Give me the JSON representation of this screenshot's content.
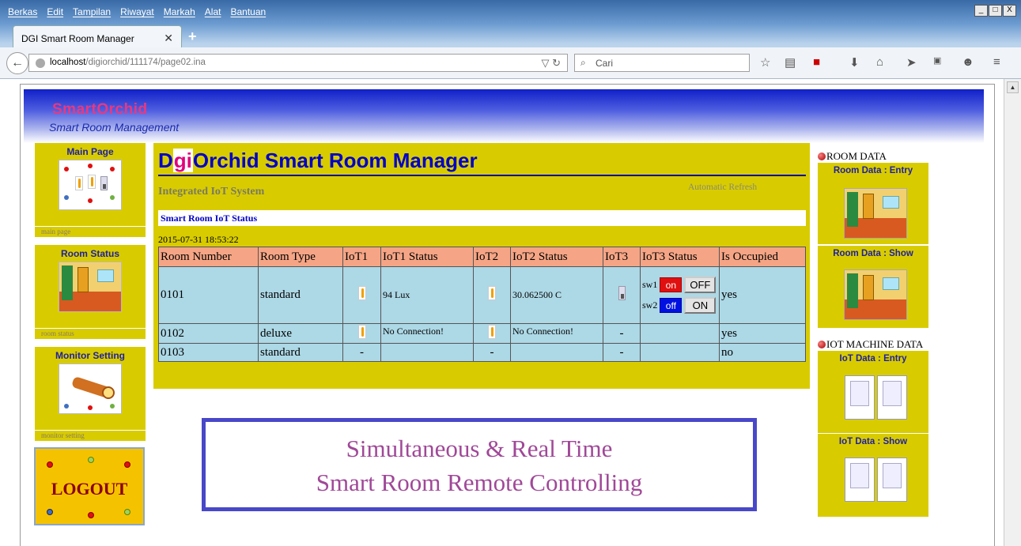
{
  "browser": {
    "menu": [
      "Berkas",
      "Edit",
      "Tampilan",
      "Riwayat",
      "Markah",
      "Alat",
      "Bantuan"
    ],
    "tab_title": "DGI Smart Room Manager",
    "url_host": "localhost",
    "url_path": "/digiorchid/111174/page02.ina",
    "search_placeholder": "Cari",
    "window_buttons": [
      "_",
      "□",
      "X"
    ]
  },
  "banner": {
    "brand": "SmartOrchid",
    "subtitle": "Smart Room Management"
  },
  "left_nav": [
    {
      "title": "Main Page",
      "footer": "main page"
    },
    {
      "title": "Room Status",
      "footer": "room status"
    },
    {
      "title": "Monitor Setting",
      "footer": "monitor setting"
    }
  ],
  "logout_label": "LOGOUT",
  "main": {
    "title_prefix": "D",
    "title_highlight": "gi",
    "title_rest": "Orchid Smart Room Manager",
    "integrated": "Integrated IoT System",
    "auto_refresh": "Automatic Refresh",
    "status_heading": "Smart Room IoT Status",
    "datetime": "2015-07-31 18:53:22",
    "columns": [
      "Room Number",
      "Room Type",
      "IoT1",
      "IoT1 Status",
      "IoT2",
      "IoT2 Status",
      "IoT3",
      "IoT3 Status",
      "Is Occupied"
    ],
    "rows": [
      {
        "room": "0101",
        "type": "standard",
        "iot1_status": "94 Lux",
        "iot2_status": "30.062500 C",
        "occupied": "yes"
      },
      {
        "room": "0102",
        "type": "deluxe",
        "iot1_status": "No Connection!",
        "iot2_status": "No Connection!",
        "iot3": "-",
        "occupied": "yes"
      },
      {
        "room": "0103",
        "type": "standard",
        "iot1": "-",
        "iot2": "-",
        "iot3": "-",
        "occupied": "no"
      }
    ],
    "switches": {
      "sw1_label": "sw1",
      "sw1_state": "on",
      "sw1_button": "OFF",
      "sw2_label": "sw2",
      "sw2_state": "off",
      "sw2_button": "ON"
    }
  },
  "slogan": {
    "line1": "Simultaneous & Real Time",
    "line2": "Smart Room Remote Controlling"
  },
  "right_panel": {
    "room_data_heading": "ROOM DATA",
    "room_entry": "Room Data : Entry",
    "room_show": "Room Data : Show",
    "iot_heading": "IOT MACHINE DATA",
    "iot_entry": "IoT Data : Entry",
    "iot_show": "IoT Data : Show"
  },
  "colors": {
    "panel": "#d8cc00",
    "title_blue": "#0000c8",
    "header_salmon": "#f5a585",
    "cell_blue": "#add8e6",
    "on_red": "#e01010",
    "off_blue": "#0010e0",
    "slogan_purple": "#a04898"
  },
  "icons": [
    "back-arrow-icon",
    "globe-icon",
    "search-icon",
    "star-icon",
    "home-icon",
    "download-icon",
    "thermometer-icon",
    "light-sensor-icon",
    "switch-icon",
    "telescope-icon"
  ]
}
